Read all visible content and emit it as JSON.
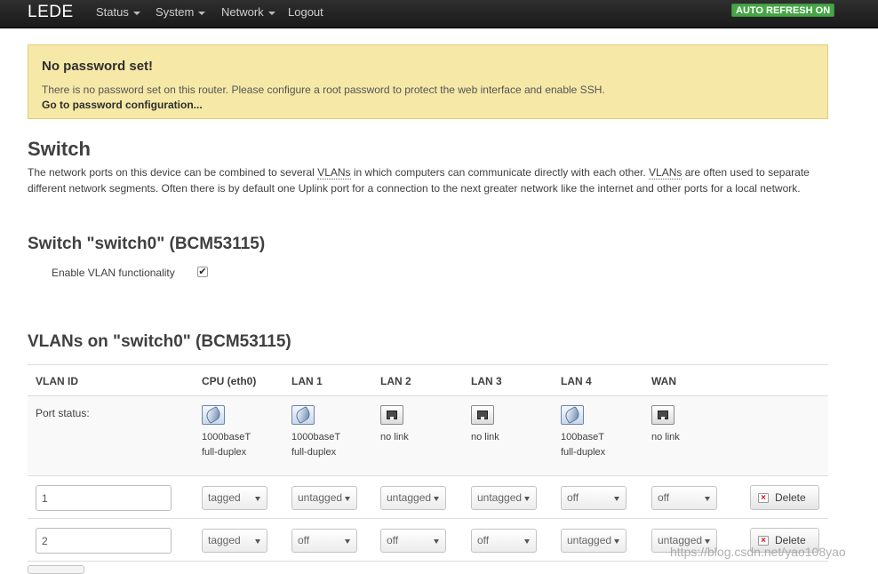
{
  "header": {
    "brand": "LEDE",
    "nav": [
      "Status",
      "System",
      "Network",
      "Logout"
    ],
    "auto_refresh": "AUTO REFRESH ON"
  },
  "alert": {
    "title": "No password set!",
    "text": "There is no password set on this router. Please configure a root password to protect the web interface and enable SSH.",
    "link": "Go to password configuration..."
  },
  "page": {
    "title": "Switch",
    "desc_part1": "The network ports on this device can be combined to several ",
    "vlans_abbr": "VLANs",
    "desc_part2": " in which computers can communicate directly with each other. ",
    "desc_part3": " are often used to separate different network segments. Often there is by default one Uplink port for a connection to the next greater network like the internet and other ports for a local network."
  },
  "switch": {
    "title": "Switch \"switch0\" (BCM53115)",
    "enable_vlan_label": "Enable VLAN functionality",
    "enable_vlan_checked": true
  },
  "vlans": {
    "title": "VLANs on \"switch0\" (BCM53115)",
    "headers": [
      "VLAN ID",
      "CPU (eth0)",
      "LAN 1",
      "LAN 2",
      "LAN 3",
      "LAN 4",
      "WAN"
    ],
    "port_status_label": "Port status:",
    "ports": [
      {
        "linked": true,
        "line1": "1000baseT",
        "line2": "full-duplex"
      },
      {
        "linked": true,
        "line1": "1000baseT",
        "line2": "full-duplex"
      },
      {
        "linked": false,
        "line1": "no link",
        "line2": ""
      },
      {
        "linked": false,
        "line1": "no link",
        "line2": ""
      },
      {
        "linked": true,
        "line1": "100baseT",
        "line2": "full-duplex"
      },
      {
        "linked": false,
        "line1": "no link",
        "line2": ""
      }
    ],
    "rows": [
      {
        "id": "1",
        "values": [
          "tagged",
          "untagged",
          "untagged",
          "untagged",
          "off",
          "off"
        ]
      },
      {
        "id": "2",
        "values": [
          "tagged",
          "off",
          "off",
          "off",
          "untagged",
          "untagged"
        ]
      }
    ],
    "delete_label": "Delete"
  },
  "watermark": "https://blog.csdn.net/yao108yao"
}
